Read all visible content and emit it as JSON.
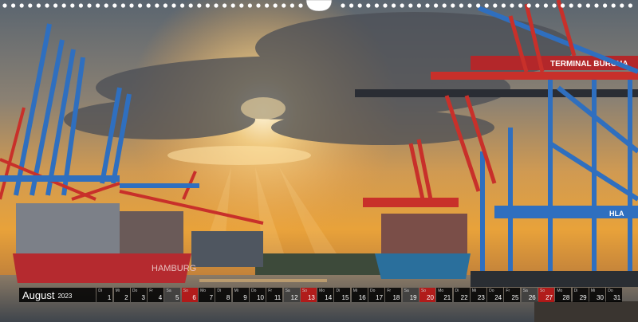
{
  "calendar": {
    "month": "August",
    "year": "2023",
    "days": [
      {
        "wd": "Di",
        "d": "1",
        "type": "wk"
      },
      {
        "wd": "Mi",
        "d": "2",
        "type": "wk"
      },
      {
        "wd": "Do",
        "d": "3",
        "type": "wk"
      },
      {
        "wd": "Fr",
        "d": "4",
        "type": "wk"
      },
      {
        "wd": "Sa",
        "d": "5",
        "type": "sat"
      },
      {
        "wd": "So",
        "d": "6",
        "type": "sun"
      },
      {
        "wd": "Mo",
        "d": "7",
        "type": "wk"
      },
      {
        "wd": "Di",
        "d": "8",
        "type": "wk"
      },
      {
        "wd": "Mi",
        "d": "9",
        "type": "wk"
      },
      {
        "wd": "Do",
        "d": "10",
        "type": "wk"
      },
      {
        "wd": "Fr",
        "d": "11",
        "type": "wk"
      },
      {
        "wd": "Sa",
        "d": "12",
        "type": "sat"
      },
      {
        "wd": "So",
        "d": "13",
        "type": "sun"
      },
      {
        "wd": "Mo",
        "d": "14",
        "type": "wk"
      },
      {
        "wd": "Di",
        "d": "15",
        "type": "wk"
      },
      {
        "wd": "Mi",
        "d": "16",
        "type": "wk"
      },
      {
        "wd": "Do",
        "d": "17",
        "type": "wk"
      },
      {
        "wd": "Fr",
        "d": "18",
        "type": "wk"
      },
      {
        "wd": "Sa",
        "d": "19",
        "type": "sat"
      },
      {
        "wd": "So",
        "d": "20",
        "type": "sun"
      },
      {
        "wd": "Mo",
        "d": "21",
        "type": "wk"
      },
      {
        "wd": "Di",
        "d": "22",
        "type": "wk"
      },
      {
        "wd": "Mi",
        "d": "23",
        "type": "wk"
      },
      {
        "wd": "Do",
        "d": "24",
        "type": "wk"
      },
      {
        "wd": "Fr",
        "d": "25",
        "type": "wk"
      },
      {
        "wd": "Sa",
        "d": "26",
        "type": "sat"
      },
      {
        "wd": "So",
        "d": "27",
        "type": "sun"
      },
      {
        "wd": "Mo",
        "d": "28",
        "type": "wk"
      },
      {
        "wd": "Di",
        "d": "29",
        "type": "wk"
      },
      {
        "wd": "Mi",
        "d": "30",
        "type": "wk"
      },
      {
        "wd": "Do",
        "d": "31",
        "type": "wk"
      }
    ]
  },
  "photo": {
    "terminal_sign": "TERMINAL BURCHA",
    "crane_label": "HLA",
    "ship_hull_text": "HAMBURG"
  },
  "colors": {
    "sky_top": "#5f6a74",
    "sun_glow": "#f5b640",
    "crane_blue": "#2f6fbf",
    "crane_red": "#c8302a",
    "hull_red": "#b52a2f",
    "hull_blue": "#2a6f9c",
    "calendar_bg": "#111111",
    "sunday_red": "#b91414"
  }
}
